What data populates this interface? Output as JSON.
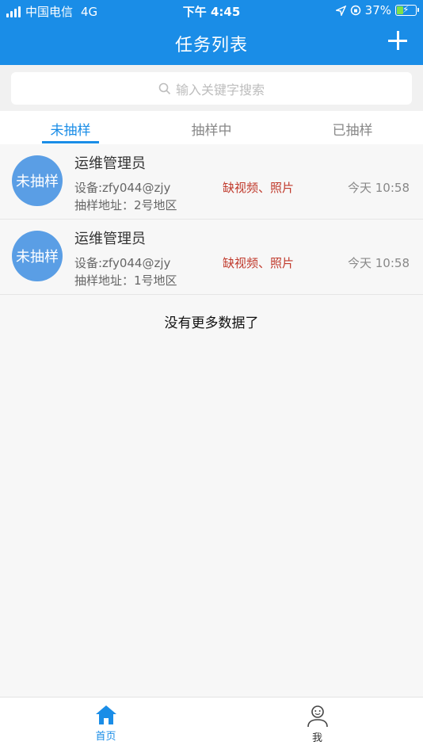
{
  "status_bar": {
    "carrier": "中国电信",
    "network": "4G",
    "time": "下午 4:45",
    "battery_percent": "37%",
    "battery_level": 0.37
  },
  "header": {
    "title": "任务列表",
    "add_icon": "plus-icon"
  },
  "search": {
    "placeholder": "输入关键字搜索",
    "icon": "search-icon"
  },
  "tabs": [
    {
      "label": "未抽样",
      "active": true
    },
    {
      "label": "抽样中",
      "active": false
    },
    {
      "label": "已抽样",
      "active": false
    }
  ],
  "tasks": [
    {
      "avatar_text": "未抽样",
      "name": "运维管理员",
      "device": "设备:zfy044@zjy",
      "address": "抽样地址：2号地区",
      "missing": "缺视频、照片",
      "time": "今天 10:58"
    },
    {
      "avatar_text": "未抽样",
      "name": "运维管理员",
      "device": "设备:zfy044@zjy",
      "address": "抽样地址：1号地区",
      "missing": "缺视频、照片",
      "time": "今天 10:58"
    }
  ],
  "no_more_text": "没有更多数据了",
  "bottom_nav": [
    {
      "label": "首页",
      "icon": "home-icon",
      "active": true
    },
    {
      "label": "我",
      "icon": "user-icon",
      "active": false
    }
  ],
  "colors": {
    "primary": "#1a8de7",
    "avatar": "#5a9ee5",
    "missing": "#c0392b"
  }
}
